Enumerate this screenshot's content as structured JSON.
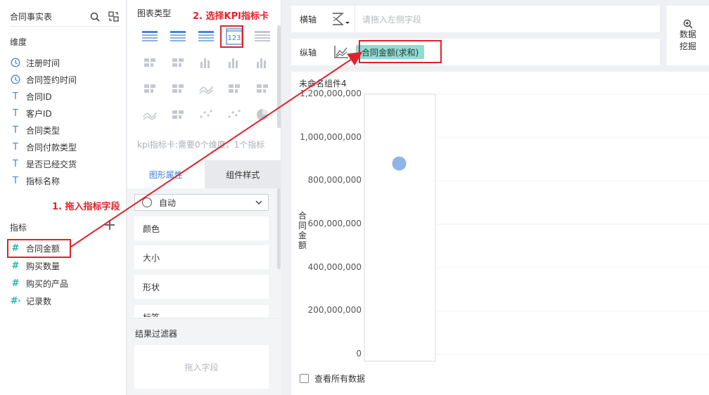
{
  "left_panel": {
    "dataset_title": "合同事实表",
    "dimensions_title": "维度",
    "dimensions": [
      {
        "label": "注册时间",
        "type": "time-icon"
      },
      {
        "label": "合同签约时间",
        "type": "time-icon"
      },
      {
        "label": "合同ID",
        "type": "text-icon"
      },
      {
        "label": "客户ID",
        "type": "text-icon"
      },
      {
        "label": "合同类型",
        "type": "text-icon"
      },
      {
        "label": "合同付款类型",
        "type": "text-icon"
      },
      {
        "label": "是否已经交货",
        "type": "text-icon"
      },
      {
        "label": "指标名称",
        "type": "text-icon"
      }
    ],
    "measures_title": "指标",
    "measures": [
      {
        "label": "合同金额",
        "type": "number-icon"
      },
      {
        "label": "购买数量",
        "type": "number-icon"
      },
      {
        "label": "购买的产品",
        "type": "number-icon"
      },
      {
        "label": "记录数",
        "type": "count-icon"
      }
    ]
  },
  "middle_panel": {
    "chart_types_title": "图表类型",
    "kpi_glyph": "123",
    "kpi_tip": "kpi指标卡:需要0个维度，1个指标",
    "tabs": [
      {
        "label": "图形属性",
        "active": true
      },
      {
        "label": "组件样式",
        "active": false
      }
    ],
    "shape_select": "自动",
    "properties": [
      "颜色",
      "大小",
      "形状",
      "标签"
    ],
    "filter_title": "结果过滤器",
    "filter_placeholder": "拖入字段"
  },
  "axes": {
    "x_label": "横轴",
    "x_placeholder": "请拖入左侧字段",
    "y_label": "纵轴",
    "y_chip": "合同金额(求和)"
  },
  "mine_button": "数据挖掘",
  "canvas": {
    "title": "未命名组件4",
    "view_all": "查看所有数据"
  },
  "chart_data": {
    "type": "scatter",
    "ylabel": "合同金额",
    "xlabel": "",
    "ylim": [
      0,
      1200000000
    ],
    "yticks": [
      "1,200,000,000",
      "1,000,000,000",
      "800,000,000",
      "600,000,000",
      "400,000,000",
      "200,000,000",
      "0"
    ],
    "points": [
      {
        "y": 880000000
      }
    ],
    "point_color": "#8fb4e8",
    "grid": true
  },
  "annotations": {
    "step1": "1. 拖入指标字段",
    "step2": "2. 选择KPI指标卡",
    "color": "#e0212a"
  }
}
